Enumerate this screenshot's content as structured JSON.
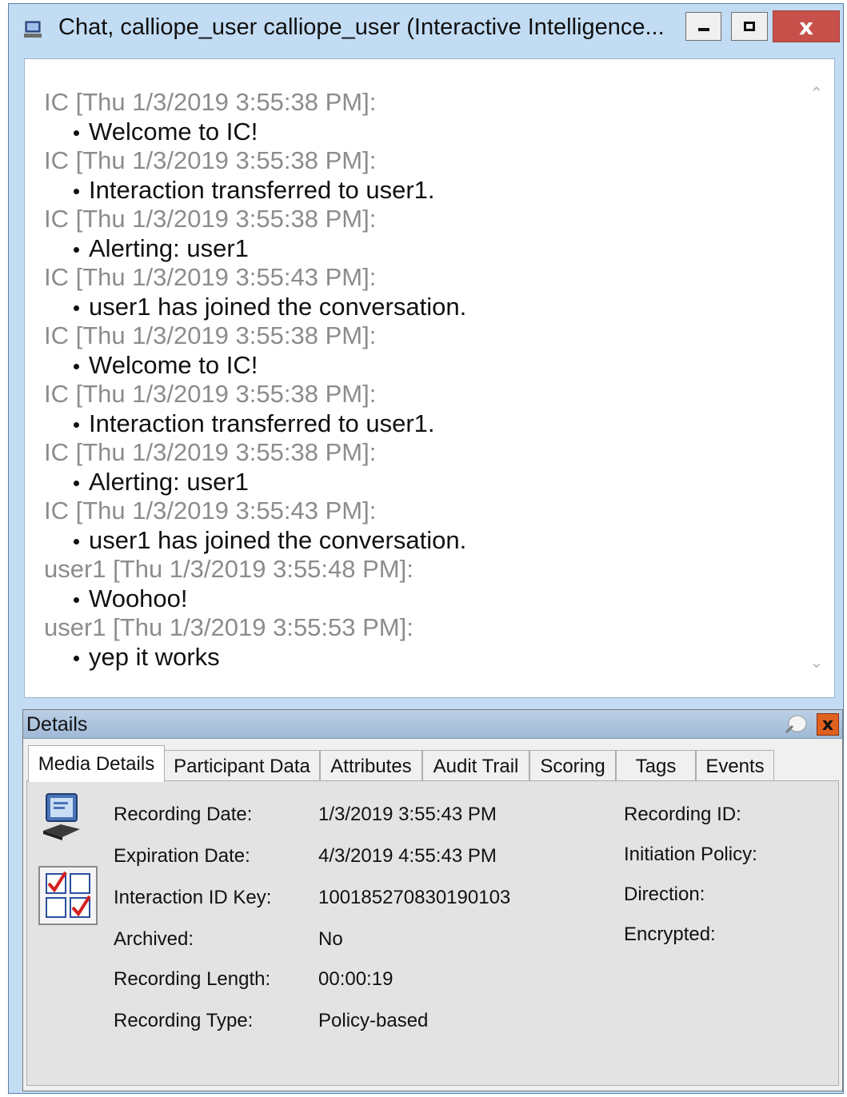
{
  "window": {
    "title": "Chat, calliope_user calliope_user (Interactive Intelligence...",
    "title_icon": "chat-window-icon",
    "close_label": "x"
  },
  "chat": {
    "messages": [
      {
        "header": "IC [Thu 1/3/2019 3:55:38 PM]:",
        "body": "Welcome to IC!"
      },
      {
        "header": "IC [Thu 1/3/2019 3:55:38 PM]:",
        "body": "Interaction transferred to user1."
      },
      {
        "header": "IC [Thu 1/3/2019 3:55:38 PM]:",
        "body": "Alerting: user1"
      },
      {
        "header": "IC [Thu 1/3/2019 3:55:43 PM]:",
        "body": "user1 has joined the conversation."
      },
      {
        "header": "IC [Thu 1/3/2019 3:55:38 PM]:",
        "body": "Welcome to IC!"
      },
      {
        "header": "IC [Thu 1/3/2019 3:55:38 PM]:",
        "body": "Interaction transferred to user1."
      },
      {
        "header": "IC [Thu 1/3/2019 3:55:38 PM]:",
        "body": "Alerting: user1"
      },
      {
        "header": "IC [Thu 1/3/2019 3:55:43 PM]:",
        "body": "user1 has joined the conversation."
      },
      {
        "header": "user1 [Thu 1/3/2019 3:55:48 PM]:",
        "body": "Woohoo!"
      },
      {
        "header": "user1 [Thu 1/3/2019 3:55:53 PM]:",
        "body": "yep it works"
      }
    ]
  },
  "details": {
    "title": "Details",
    "close_label": "x",
    "tabs": [
      {
        "label": "Media Details",
        "active": true
      },
      {
        "label": "Participant Data",
        "active": false
      },
      {
        "label": "Attributes",
        "active": false
      },
      {
        "label": "Audit Trail",
        "active": false
      },
      {
        "label": "Scoring",
        "active": false
      },
      {
        "label": "Tags",
        "active": false
      },
      {
        "label": "Events",
        "active": false
      }
    ],
    "fields": [
      {
        "label": "Recording Date:",
        "value": "1/3/2019 3:55:43 PM"
      },
      {
        "label": "Expiration Date:",
        "value": "4/3/2019 4:55:43 PM"
      },
      {
        "label": "Interaction ID Key:",
        "value": "100185270830190103"
      },
      {
        "label": "Archived:",
        "value": "No"
      },
      {
        "label": "Recording Length:",
        "value": "00:00:19"
      },
      {
        "label": "Recording Type:",
        "value": "Policy-based"
      }
    ],
    "right_fields": [
      {
        "label": "Recording ID:",
        "value": ""
      },
      {
        "label": "Initiation Policy:",
        "value": ""
      },
      {
        "label": "Direction:",
        "value": ""
      },
      {
        "label": "Encrypted:",
        "value": ""
      }
    ]
  },
  "colors": {
    "titlebar": "#c2dcf3",
    "close_button": "#c7504a",
    "header_text": "#8c8c8c",
    "details_close": "#e06020"
  }
}
